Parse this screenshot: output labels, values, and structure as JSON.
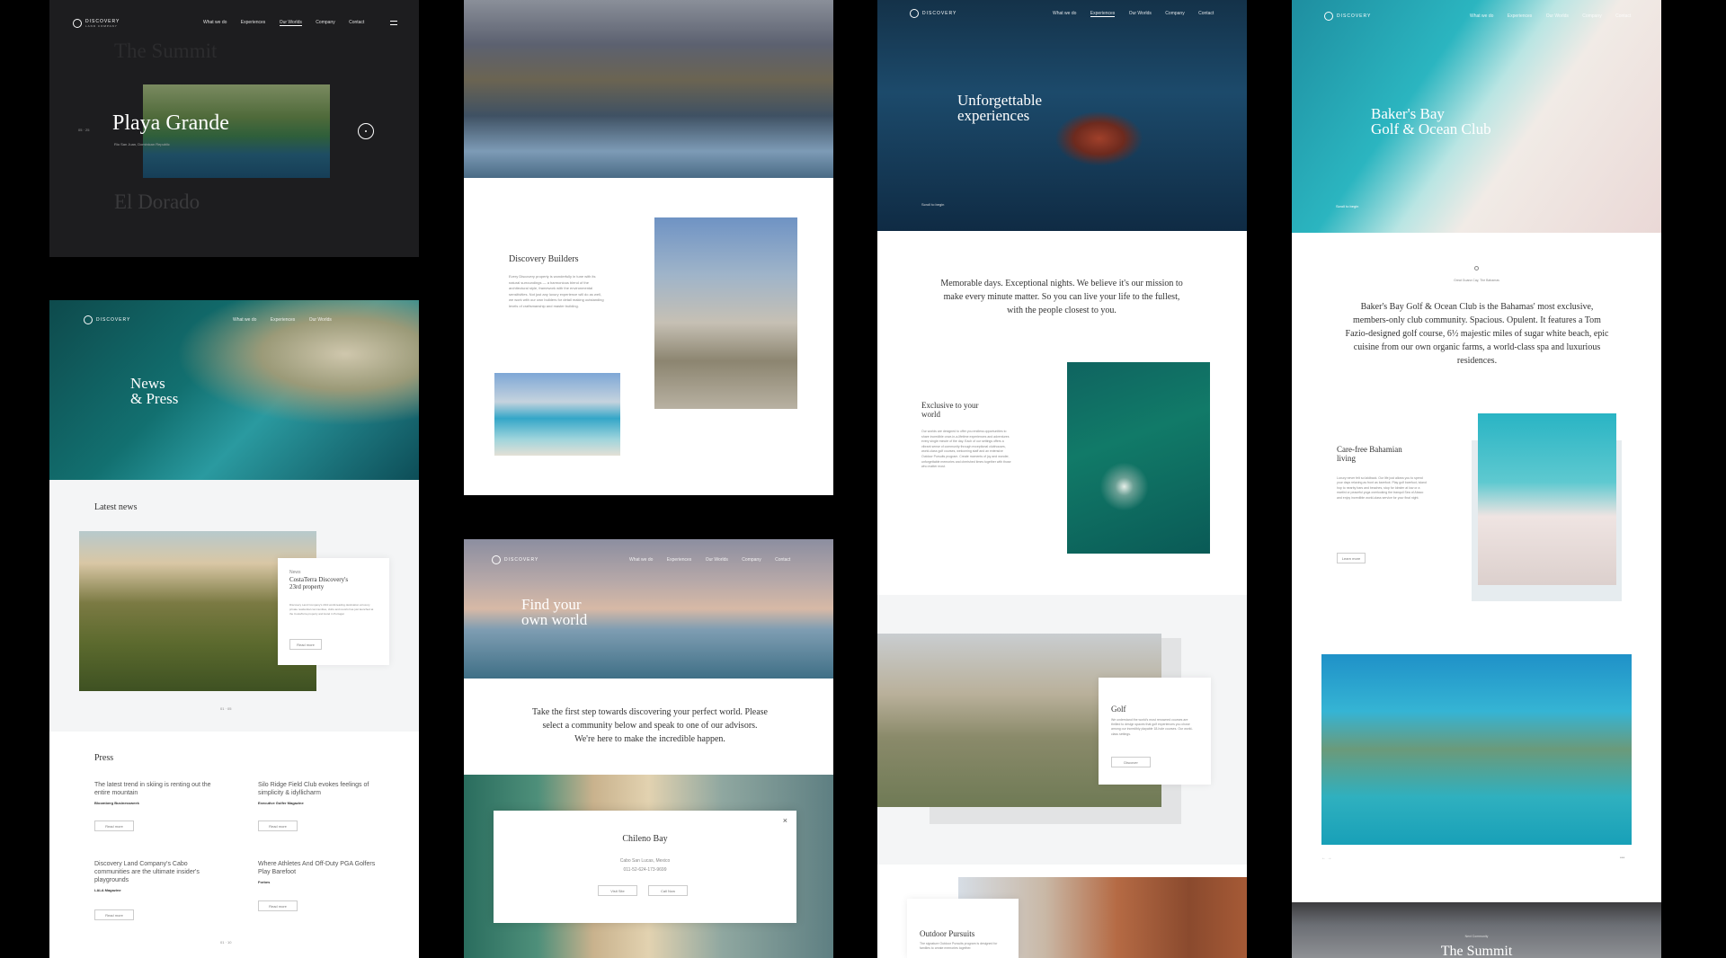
{
  "brand": {
    "name": "DISCOVERY",
    "sub": "LAND COMPANY"
  },
  "nav": [
    "What we do",
    "Experiences",
    "Our Worlds",
    "Company",
    "Contact"
  ],
  "p1": {
    "faded_top": "The Summit",
    "title": "Playa Grande",
    "location": "Rio San Juan, Dominican Republic",
    "pager": "05 · 25",
    "faded_bottom": "El Dorado"
  },
  "p2": {
    "section_title": "Discovery Builders",
    "body": "Every Discovery property is wonderfully in tune with its natural surroundings — a harmonious blend of the architectural style, framework with the environmental sensitivities. Not just any luxury experience will do as well, we work with our own builders for detail making outstanding levels of craftsmanship and master building."
  },
  "p3": {
    "hero_title_1": "Unforgettable",
    "hero_title_2": "experiences",
    "scroll": "Scroll to begin",
    "mission": "Memorable days. Exceptional nights. We believe it's our mission to make every minute matter. So you can live your life to the fullest, with the people closest to you.",
    "exclusive_title": "Exclusive to your world",
    "exclusive_body": "Our worlds are designed to offer you endless opportunities to share incredible once-in-a-lifetime experiences and adventures every single minute of the day. Each of our settings offers a vibrant sense of community through exceptional clubhouses, world-class golf courses, welcoming staff and an extensive Outdoor Pursuits program. Create moments of joy and wonder, unforgettable memories and cherished times together with those who matter most.",
    "golf_title": "Golf",
    "golf_body": "We understand the world's most renowned courses are thrilled to design spaces that golf experiences you chose among our incredibly playable 18-hole courses. Our world-class settings.",
    "golf_btn": "Discover",
    "outdoor_title": "Outdoor Pursuits",
    "outdoor_body": "The signature Outdoor Pursuits program is designed for families to create memories together."
  },
  "p4": {
    "hero_title_1": "Baker's Bay",
    "hero_title_2": "Golf & Ocean Club",
    "scroll": "Scroll to begin",
    "location": "Great Guana Cay, The Bahamas",
    "intro": "Baker's Bay Golf & Ocean Club is the Bahamas' most exclusive, members-only club community. Spacious. Opulent. It features a Tom Fazio-designed golf course, 6½ majestic miles of sugar white beach, epic cuisine from our own organic farms, a world-class spa and luxurious residences.",
    "carefree_title": "Care-free Bahamian living",
    "carefree_body": "Luxury never felt so laidback. Our life just allows you to spend your days relaxing as front as barefoot. Play golf barefoot, island hop to nearby bars and beaches, stop for lobster at low or a martini or peaceful yoga overlooking the tranquil Sea of Abaco and enjoy incredible world-class service for your final night.",
    "carefree_btn": "Learn more",
    "footer_title": "The Summit",
    "footer_sub": "Next Community"
  },
  "p5": {
    "title_1": "News",
    "title_2": "& Press",
    "latest": "Latest news",
    "card_tag": "News",
    "card_title": "CostaTerra Discovery's 23rd property",
    "card_body": "Discovery Land Company's 23rd world-leading destination at luxury private residential communities, clubs and resorts has just launched at the CostaTerra property and Hotel in Portugal.",
    "card_btn": "Read more",
    "pager": "01 · 05",
    "press": "Press",
    "items": [
      {
        "title": "The latest trend in skiing is renting out the entire mountain",
        "source": "Bloomberg Businessweek",
        "btn": "Read more"
      },
      {
        "title": "Silo Ridge Field Club evokes feelings of simplicity & idyllicharm",
        "source": "Executive Golfer Magazine",
        "btn": "Read more"
      },
      {
        "title": "Discovery Land Company's Cabo communities are the ultimate insider's playgrounds",
        "source": "LALA Magazine",
        "btn": "Read more"
      },
      {
        "title": "Where Athletes And Off-Duty PGA Golfers Play Barefoot",
        "source": "Forbes",
        "btn": "Read more"
      }
    ],
    "press_pager": "01 · 10"
  },
  "p6": {
    "title_1": "Find your",
    "title_2": "own world",
    "intro": "Take the first step towards discovering your perfect world. Please select a community below and speak to one of our advisors. We're here to make the incredible happen.",
    "modal_title": "Chileno Bay",
    "modal_loc": "Cabo San Lucas, Mexico",
    "modal_phone": "011-52-624-173-9699",
    "modal_btn1": "Visit Site",
    "modal_btn2": "Call Now",
    "close": "×"
  },
  "colors": {
    "dark": "#1d1d1f",
    "offwhite": "#f4f5f6",
    "ocean": "#1a7d92"
  }
}
